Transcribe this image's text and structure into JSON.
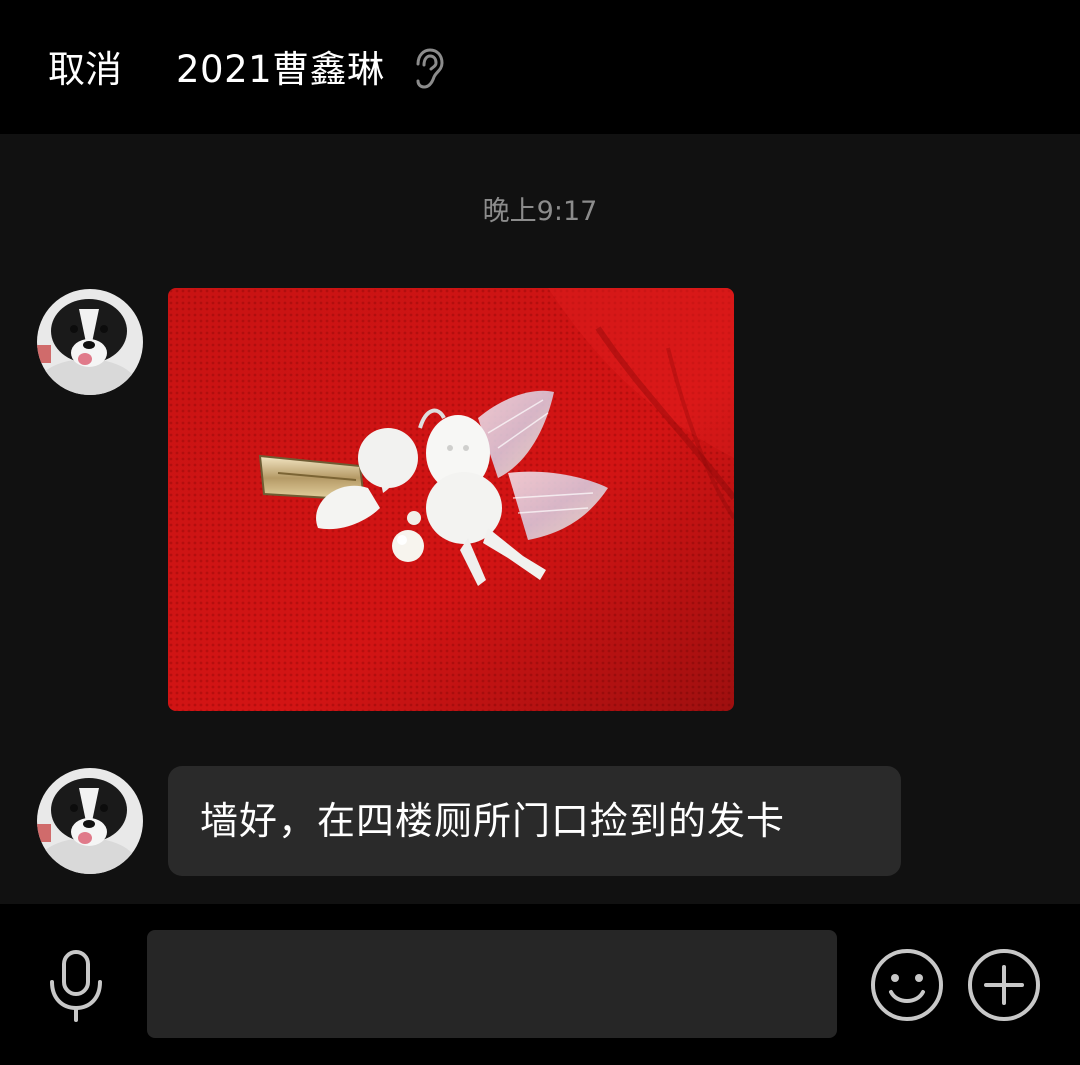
{
  "header": {
    "cancel_label": "取消",
    "chat_title": "2021曹鑫琳",
    "receiver_mode_icon": "ear-icon"
  },
  "messages": [
    {
      "type": "timestamp",
      "text": "晚上9:17"
    },
    {
      "type": "image",
      "sender_avatar": "avatar-dog",
      "image_subject": "hair clip with angel and wings on red fabric"
    },
    {
      "type": "text",
      "sender_avatar": "avatar-dog",
      "text": "墙好，在四楼厕所门口捡到的发卡"
    }
  ],
  "input_bar": {
    "voice_icon": "microphone-icon",
    "input_value": "",
    "emoji_icon": "smiley-icon",
    "more_icon": "plus-circle-icon"
  },
  "colors": {
    "header_bg": "#000000",
    "chat_bg": "#111111",
    "bubble_bg": "#2a2a2a",
    "timestamp_text": "#8c8c8c",
    "input_bg": "#262626",
    "icon_gray": "#c8c8c8"
  }
}
